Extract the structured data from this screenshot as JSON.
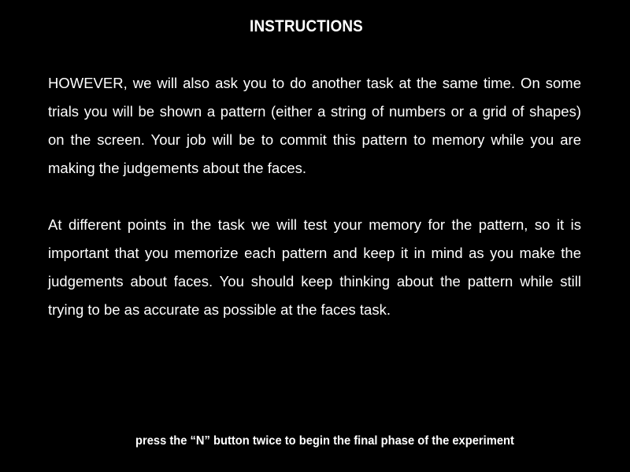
{
  "screen": {
    "title": "INSTRUCTIONS",
    "paragraphs": [
      "HOWEVER, we will also ask you to do another task at the same time.  On some trials you will be shown a pattern (either a string of numbers or a grid of shapes) on the screen.  Your job will be to commit this pattern to memory while you are making the judgements about the faces.",
      "At different points in the task we will test your memory for the pattern, so it is important that you memorize each pattern and keep it in mind as you make the judgements about faces.  You should keep thinking about the pattern while still trying to be as accurate as possible at the faces task."
    ],
    "footer": "press the “N” button twice to begin the final phase of the experiment"
  },
  "colors": {
    "background": "#000000",
    "text": "#ffffff"
  }
}
